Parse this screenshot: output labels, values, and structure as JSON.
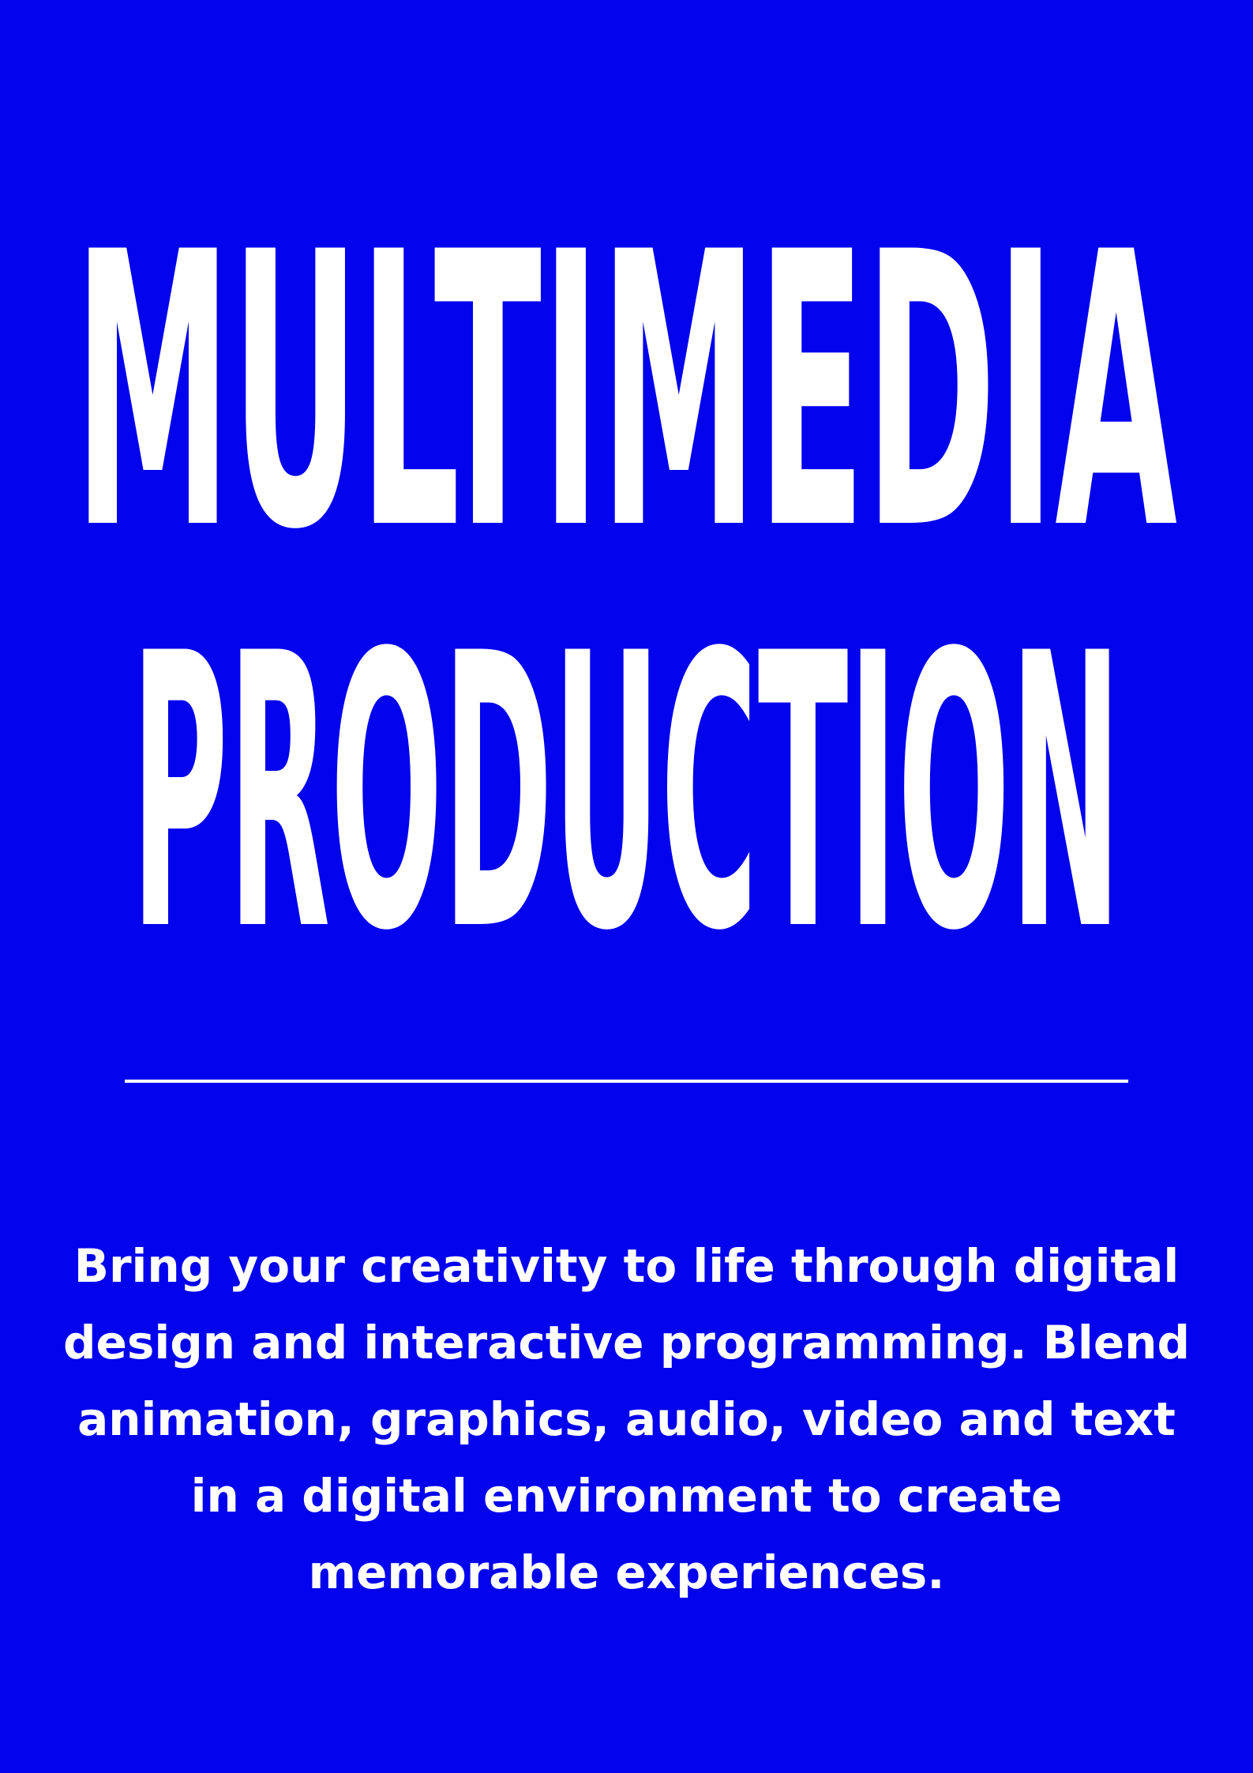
{
  "colors": {
    "background": "#0303ee",
    "text": "#ffffff"
  },
  "title": {
    "line1": "MULTIMEDIA",
    "line2": "PRODUCTION"
  },
  "description": "Bring your creativity to life through digital design and interactive programming.  Blend animation, graphics, audio, video and text in a digital environment to create memorable experiences."
}
